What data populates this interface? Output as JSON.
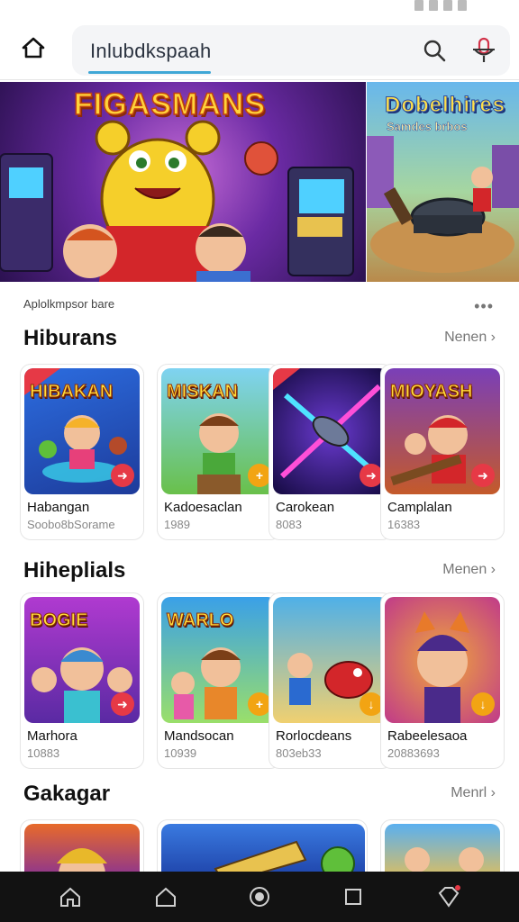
{
  "search": {
    "value": "Inlubdkspaah"
  },
  "banners": [
    {
      "title": "FIGASMANS"
    },
    {
      "title": "Dobelhires",
      "subtitle": "Samdes brbos"
    }
  ],
  "caption": "Aplolkmpsor bare",
  "sections": [
    {
      "title": "Hiburans",
      "more": "Nenen ›",
      "cards": [
        {
          "art": "HIBAKAN",
          "name": "Habangan",
          "meta": "Soobo8bSorame"
        },
        {
          "art": "MISKAN",
          "name": "Kadoesaclan",
          "meta": "1989"
        },
        {
          "art": "",
          "name": "Carokean",
          "meta": "8083"
        },
        {
          "art": "MIOYASH",
          "name": "Camplalan",
          "meta": "16383"
        }
      ]
    },
    {
      "title": "Hiheplials",
      "more": "Menen ›",
      "cards": [
        {
          "art": "BOGIE",
          "name": "Marhora",
          "meta": "10883"
        },
        {
          "art": "WARLO",
          "name": "Mandsocan",
          "meta": "10939"
        },
        {
          "art": "",
          "name": "Rorlocdeans",
          "meta": "803eb33"
        },
        {
          "art": "",
          "name": "Rabeelesaoa",
          "meta": "20883693"
        }
      ]
    },
    {
      "title": "Gakagar",
      "more": "Menrl ›"
    }
  ],
  "colors": {
    "accent": "#3fa7d6",
    "badge_red": "#e63946",
    "badge_orange": "#f2a413",
    "navbar": "#121212"
  }
}
